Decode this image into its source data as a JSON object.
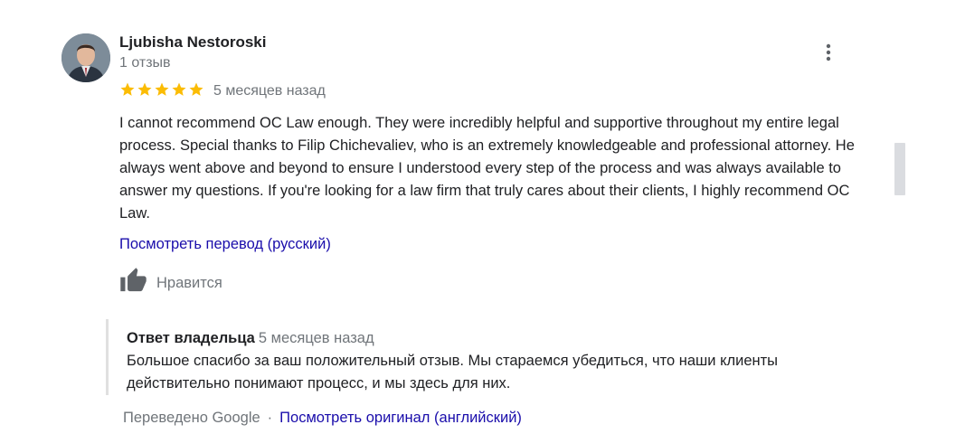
{
  "review": {
    "author_name": "Ljubisha Nestoroski",
    "author_meta": "1 отзыв",
    "rating": 5,
    "date": "5 месяцев назад",
    "text": "I cannot recommend OC Law enough. They were incredibly helpful and supportive throughout my entire legal process. Special thanks to Filip Chichevaliev, who is an extremely knowledgeable and professional attorney.  He always went above and beyond to ensure I understood every step of the process and was always available to answer my questions. If you're looking for a law firm that truly cares about their clients, I highly recommend OC Law.",
    "translate_link": "Посмотреть перевод (русский)",
    "like_label": "Нравится"
  },
  "owner_reply": {
    "title": "Ответ владельца",
    "date": "5 месяцев назад",
    "text": "Большое спасибо за ваш положительный отзыв. Мы стараемся убедиться, что наши клиенты действительно понимают процесс, и мы здесь для них."
  },
  "footer": {
    "translated_by": "Переведено Google",
    "separator": "·",
    "original_link": "Посмотреть оригинал (английский)"
  },
  "colors": {
    "star": "#fbbc04",
    "link": "#1a0dab",
    "muted": "#70757a",
    "text": "#202124"
  },
  "icons": {
    "avatar": "avatar-photo",
    "more": "more-vert-icon",
    "star": "star-icon",
    "like": "thumb-up-icon"
  }
}
